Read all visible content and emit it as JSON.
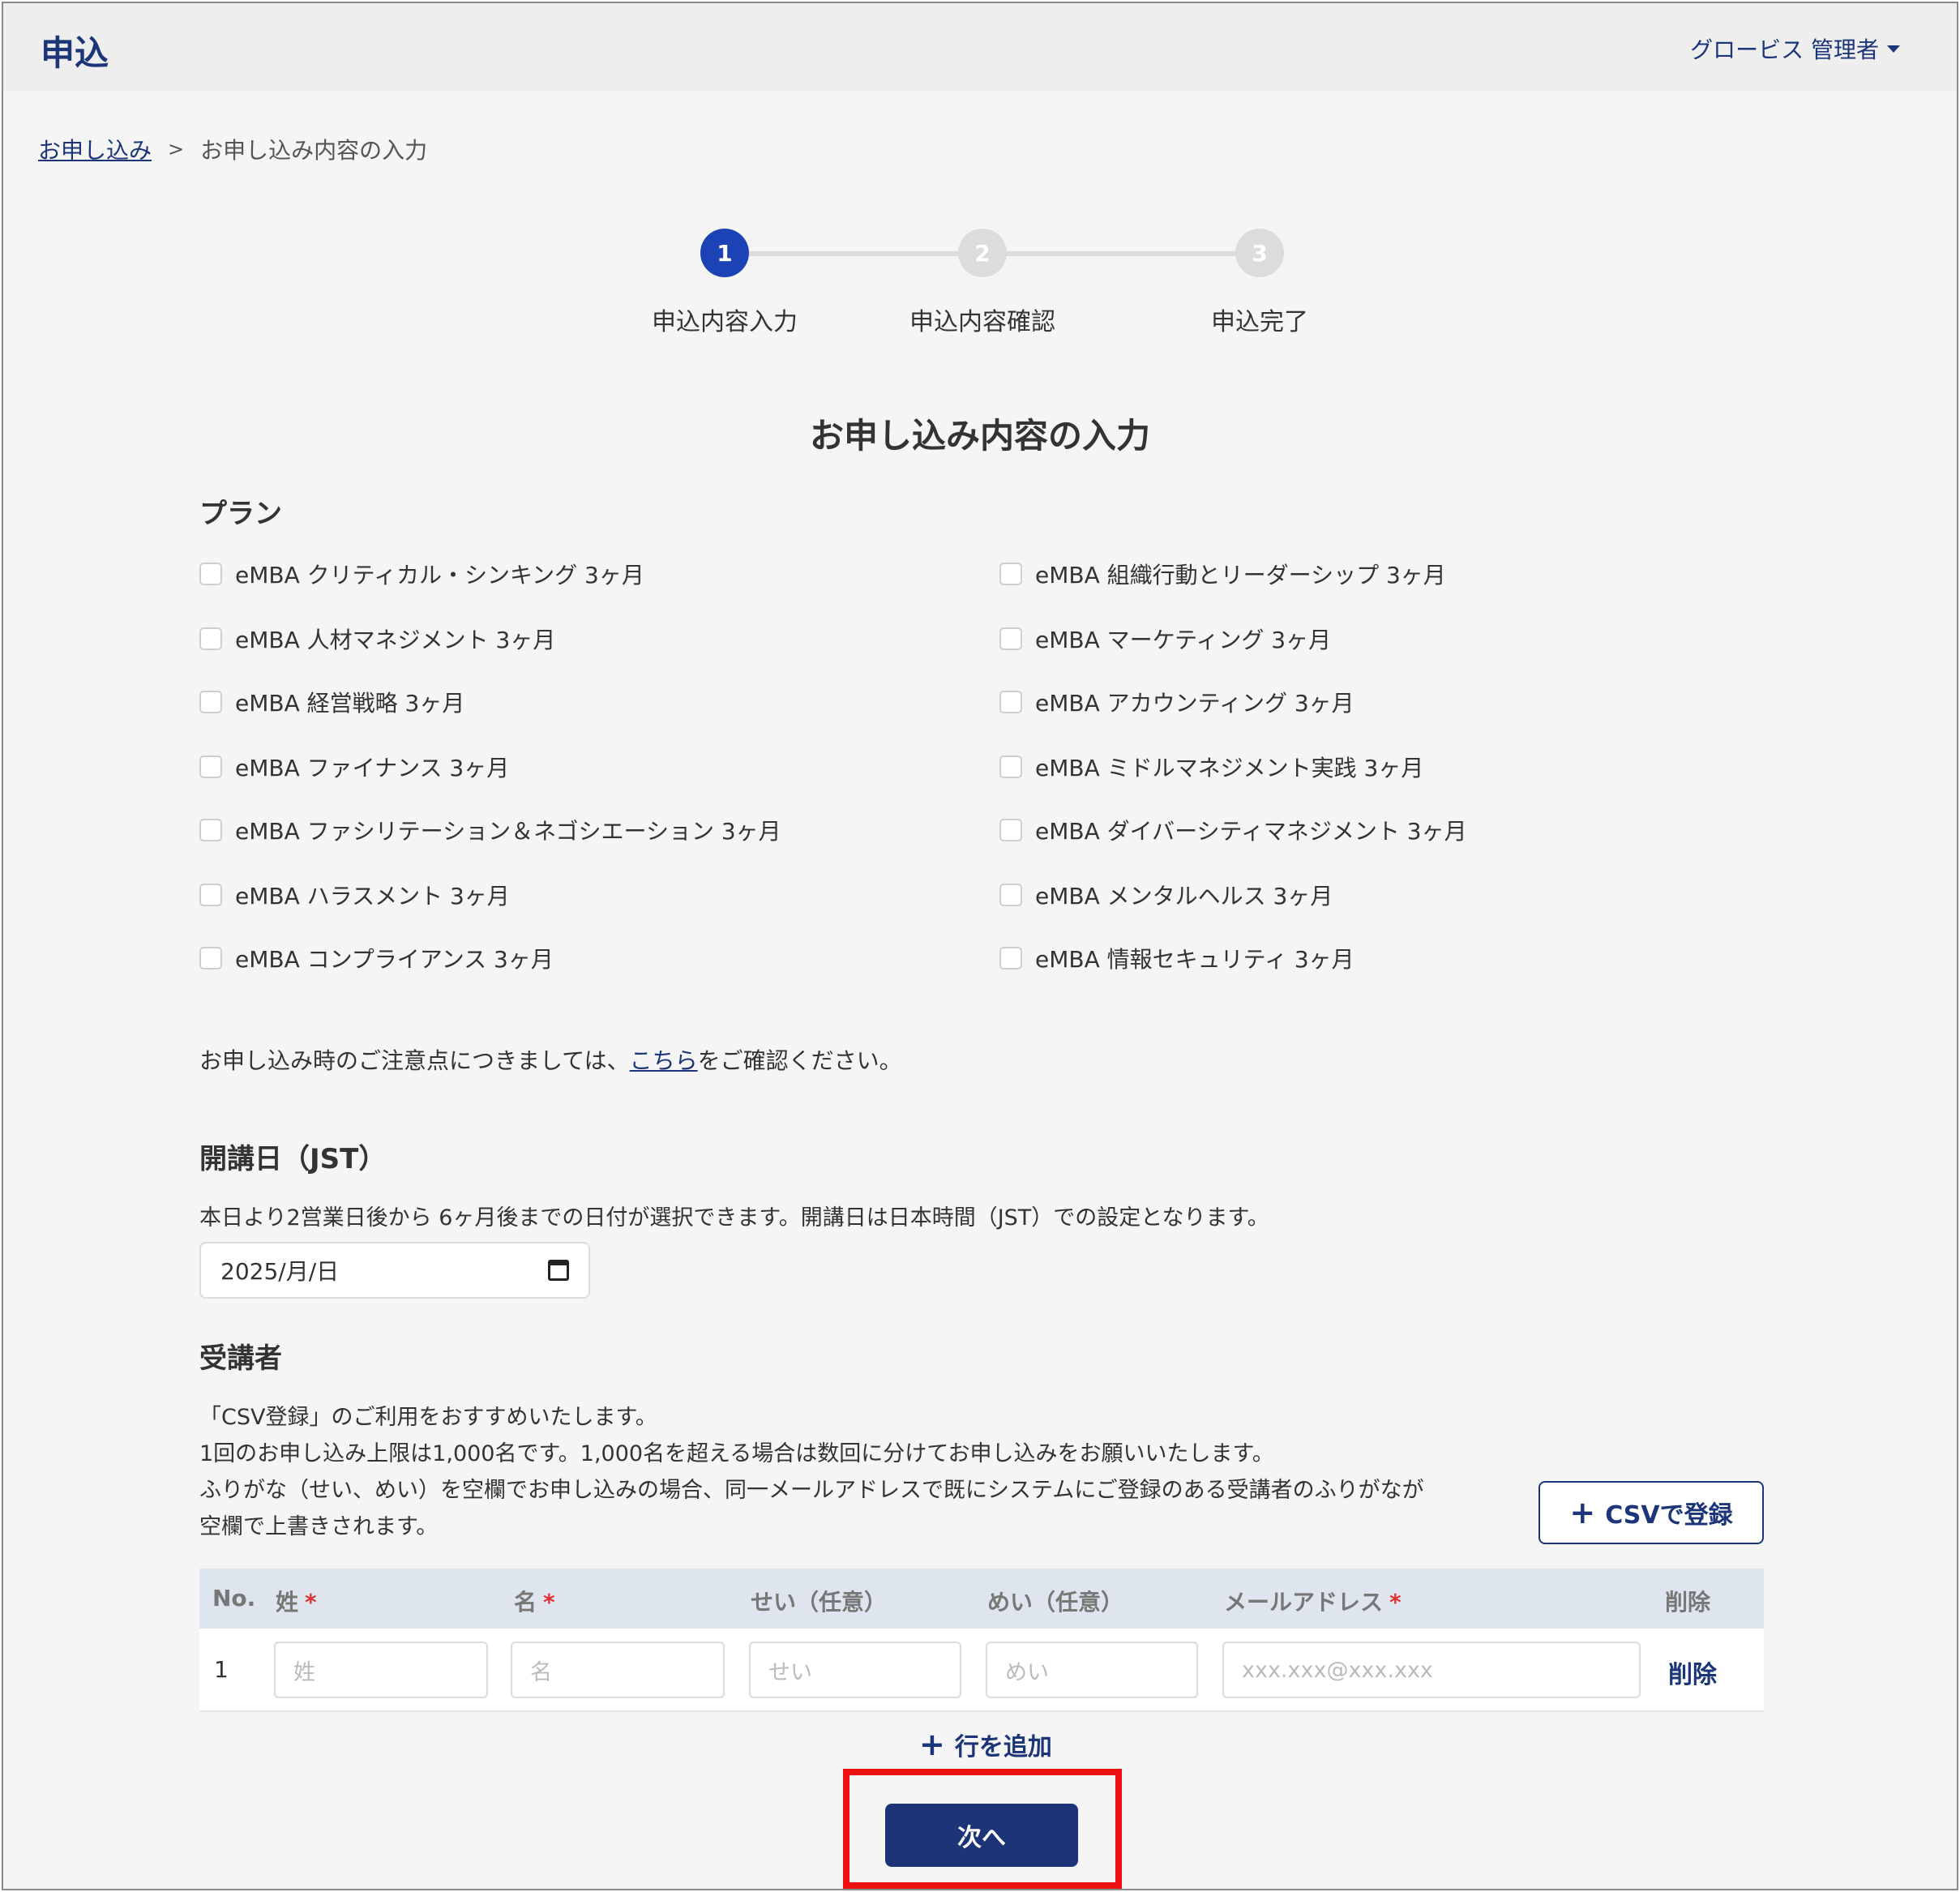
{
  "header": {
    "title": "申込",
    "user_menu_label": "グロービス 管理者"
  },
  "breadcrumb": {
    "link": "お申し込み",
    "separator": ">",
    "current": "お申し込み内容の入力"
  },
  "stepper": {
    "steps": [
      {
        "number": "1",
        "label": "申込内容入力",
        "active": true
      },
      {
        "number": "2",
        "label": "申込内容確認",
        "active": false
      },
      {
        "number": "3",
        "label": "申込完了",
        "active": false
      }
    ]
  },
  "page_title": "お申し込み内容の入力",
  "plan_section": {
    "title": "プラン",
    "left": [
      "eMBA クリティカル・シンキング 3ヶ月",
      "eMBA 人材マネジメント 3ヶ月",
      "eMBA 経営戦略 3ヶ月",
      "eMBA ファイナンス 3ヶ月",
      "eMBA ファシリテーション＆ネゴシエーション 3ヶ月",
      "eMBA ハラスメント 3ヶ月",
      "eMBA コンプライアンス 3ヶ月"
    ],
    "right": [
      "eMBA 組織行動とリーダーシップ 3ヶ月",
      "eMBA マーケティング 3ヶ月",
      "eMBA アカウンティング 3ヶ月",
      "eMBA ミドルマネジメント実践 3ヶ月",
      "eMBA ダイバーシティマネジメント 3ヶ月",
      "eMBA メンタルヘルス 3ヶ月",
      "eMBA 情報セキュリティ 3ヶ月"
    ]
  },
  "notice": {
    "before": "お申し込み時のご注意点につきましては、",
    "link": "こちら",
    "after": "をご確認ください。"
  },
  "start_date": {
    "title": "開講日（JST）",
    "description": "本日より2営業日後から 6ヶ月後までの日付が選択できます。開講日は日本時間（JST）での設定となります。",
    "value": "2025/月/日",
    "icon": "calendar-icon"
  },
  "participants": {
    "title": "受講者",
    "lines": [
      "「CSV登録」のご利用をおすすめいたします。",
      "1回のお申し込み上限は1,000名です。1,000名を超える場合は数回に分けてお申し込みをお願いいたします。",
      "ふりがな（せい、めい）を空欄でお申し込みの場合、同一メールアドレスで既にシステムにご登録のある受講者のふりがなが",
      "空欄で上書きされます。"
    ],
    "csv_button": "CSVで登録",
    "columns": {
      "no": "No.",
      "last_name": "姓",
      "first_name": "名",
      "last_kana": "せい（任意）",
      "first_kana": "めい（任意）",
      "email": "メールアドレス",
      "delete": "削除",
      "required_mark": "*"
    },
    "rows": [
      {
        "no": "1",
        "last_name_placeholder": "姓",
        "first_name_placeholder": "名",
        "last_kana_placeholder": "せい",
        "first_kana_placeholder": "めい",
        "email_placeholder": "xxx.xxx@xxx.xxx",
        "delete_label": "削除"
      }
    ],
    "add_row": "行を追加"
  },
  "next_button": "次へ",
  "colors": {
    "brand": "#1c3578",
    "step_active": "#1c43b6",
    "highlight": "#ee1111",
    "required": "#d33333"
  }
}
